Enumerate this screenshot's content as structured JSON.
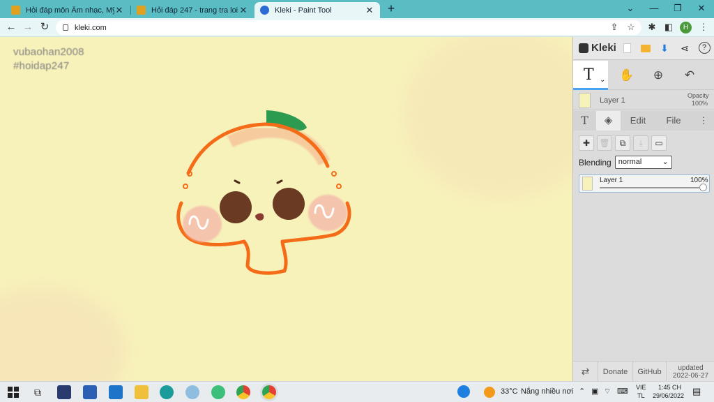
{
  "browser": {
    "tabs": [
      {
        "title": "Hỏi đáp môn Âm nhạc, Mỹ thuật",
        "active": false,
        "favicon": "hoidap247-icon",
        "color": "#e0a020"
      },
      {
        "title": "Hỏi đáp 247 - trang tra loi",
        "active": false,
        "favicon": "hoidap247-icon",
        "color": "#e0a020"
      },
      {
        "title": "Kleki - Paint Tool",
        "active": true,
        "favicon": "kleki-icon",
        "color": "#2a6bd6"
      }
    ],
    "url": "kleki.com"
  },
  "canvas": {
    "watermark_line1": "vubaohan2008",
    "watermark_line2": "#hoidap247",
    "background": "#f7f1ba"
  },
  "panel": {
    "app_name": "Kleki",
    "layer_name": "Layer 1",
    "opacity_label": "Opacity",
    "opacity_value": "100%",
    "tabs": {
      "text": "T",
      "edit": "Edit",
      "file": "File"
    },
    "blending_label": "Blending",
    "blending_value": "normal",
    "layer_card": {
      "name": "Layer 1",
      "opacity": "100%",
      "opacity_fraction": 1.0
    },
    "footer": {
      "donate": "Donate",
      "github": "GitHub",
      "updated_label": "updated",
      "updated_date": "2022-06-27"
    }
  },
  "taskbar": {
    "weather_temp": "33°C",
    "weather_text": "Nắng nhiều nơi",
    "lang_top": "VIE",
    "lang_bottom": "TL",
    "time": "1:45 CH",
    "date": "29/06/2022"
  }
}
